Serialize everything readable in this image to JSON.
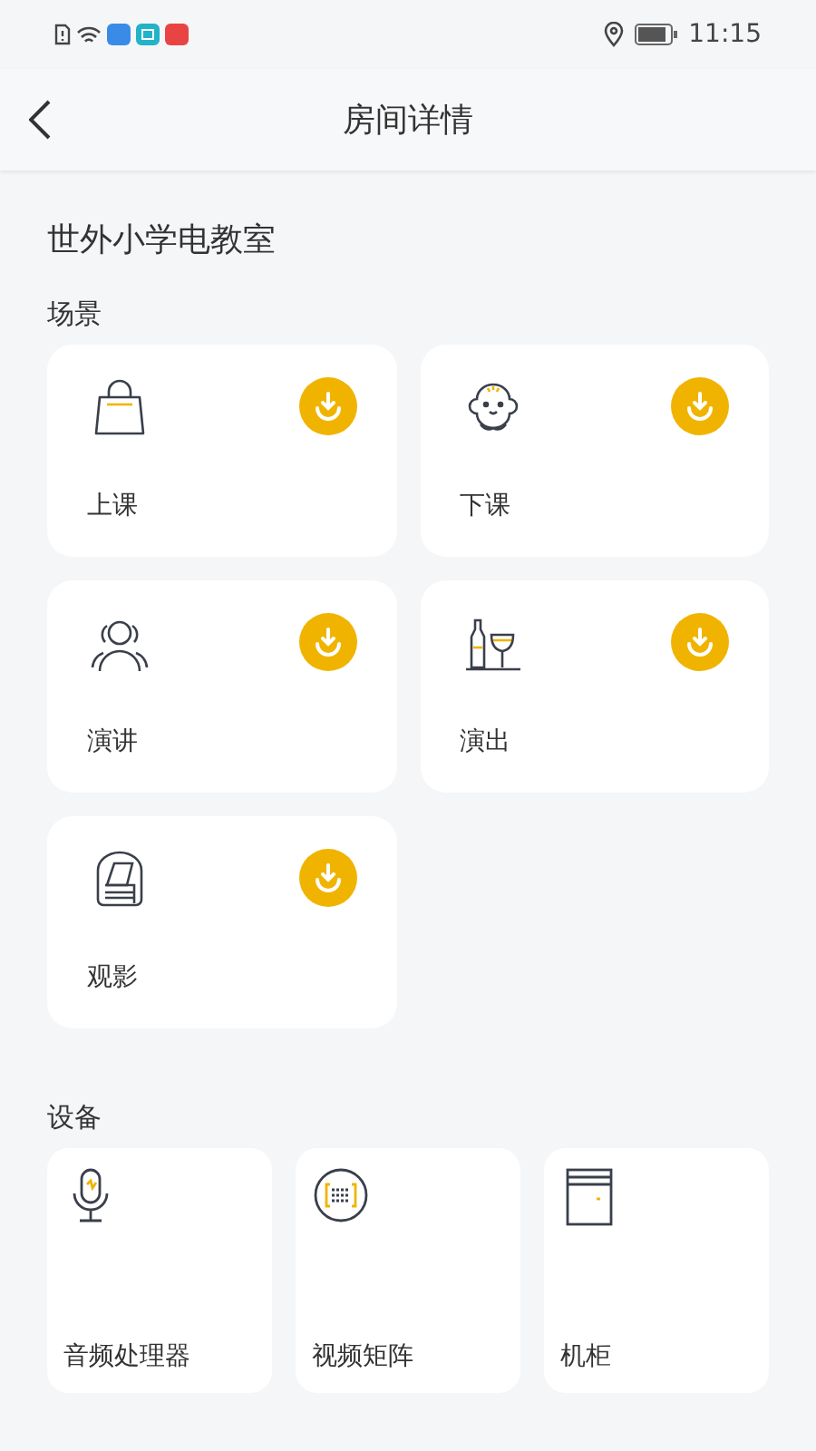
{
  "status_bar": {
    "time": "11:15"
  },
  "header": {
    "title": "房间详情"
  },
  "room": {
    "name": "世外小学电教室"
  },
  "scenes": {
    "title": "场景",
    "items": [
      {
        "label": "上课",
        "kind": "bag"
      },
      {
        "label": "下课",
        "kind": "baby"
      },
      {
        "label": "演讲",
        "kind": "people"
      },
      {
        "label": "演出",
        "kind": "drinks"
      },
      {
        "label": "观影",
        "kind": "armchair"
      }
    ]
  },
  "devices": {
    "title": "设备",
    "items": [
      {
        "label": "音频处理器",
        "kind": "mic"
      },
      {
        "label": "视频矩阵",
        "kind": "matrix"
      },
      {
        "label": "机柜",
        "kind": "cabinet"
      }
    ]
  }
}
